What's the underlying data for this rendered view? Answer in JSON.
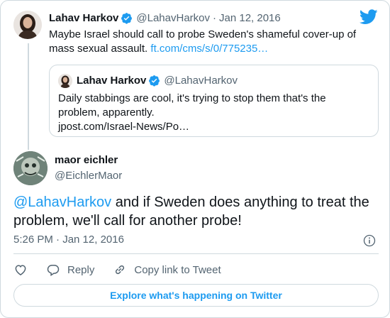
{
  "parent_tweet": {
    "name": "Lahav Harkov",
    "handle": "@LahavHarkov",
    "separator": "·",
    "date": "Jan 12, 2016",
    "text": "Maybe Israel should call to probe Sweden's shameful cover-up of mass sexual assault.",
    "link": "ft.com/cms/s/0/775235…",
    "quoted": {
      "name": "Lahav Harkov",
      "handle": "@LahavHarkov",
      "text": "Daily stabbings are cool, it's trying to stop them that's the problem, apparently.",
      "link": "jpost.com/Israel-News/Po…"
    }
  },
  "main_tweet": {
    "name": "maor eichler",
    "handle": "@EichlerMaor",
    "mention": "@LahavHarkov",
    "text": " and if Sweden does anything to treat the problem, we'll call for another probe!",
    "time": "5:26 PM · Jan 12, 2016"
  },
  "actions": {
    "reply_label": "Reply",
    "copy_link_label": "Copy link to Tweet"
  },
  "explore_label": "Explore what's happening on Twitter",
  "colors": {
    "accent": "#1d9bf0",
    "text": "#0f1419",
    "secondary": "#536471",
    "border": "#cfd9de"
  },
  "icons": [
    "twitter-bird-icon",
    "verified-badge-icon",
    "info-icon",
    "heart-icon",
    "reply-icon",
    "link-icon"
  ]
}
